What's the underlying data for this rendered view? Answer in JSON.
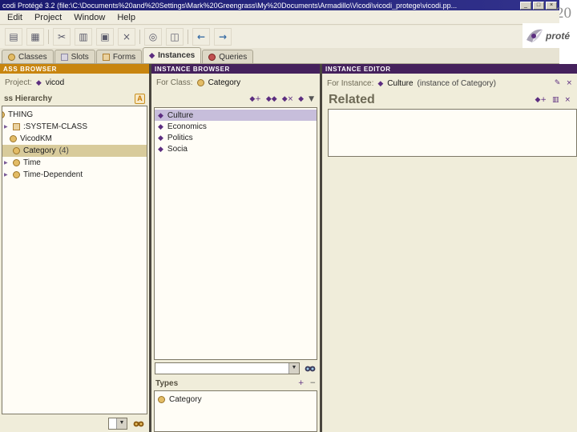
{
  "slide": {
    "page_number": "20"
  },
  "window": {
    "title": "codi  Protégé 3.2    (file:\\C:\\Documents%20and%20Settings\\Mark%20Greengrass\\My%20Documents\\Armadillo\\Vicodi\\vicodi_protege\\vicodi.pp...",
    "minimize_glyph": "_",
    "maximize_glyph": "□",
    "close_glyph": "×"
  },
  "menubar": {
    "items": [
      "Edit",
      "Project",
      "Window",
      "Help"
    ]
  },
  "toolbar": {
    "icons": [
      {
        "name": "new-project",
        "glyph": "▤"
      },
      {
        "name": "save-project",
        "glyph": "▦"
      },
      {
        "name": "cut",
        "glyph": "✂"
      },
      {
        "name": "copy",
        "glyph": "▥"
      },
      {
        "name": "paste",
        "glyph": "▣"
      },
      {
        "name": "delete",
        "glyph": "×"
      },
      {
        "name": "find",
        "glyph": "◎"
      },
      {
        "name": "diagram",
        "glyph": "◫"
      },
      {
        "name": "back",
        "glyph": "←"
      },
      {
        "name": "forward",
        "glyph": "→"
      }
    ],
    "logo_text": "proté"
  },
  "tabs": [
    {
      "label": "Classes",
      "active": false
    },
    {
      "label": "Slots",
      "active": false
    },
    {
      "label": "Forms",
      "active": false
    },
    {
      "label": "Instances",
      "active": true
    },
    {
      "label": "Queries",
      "active": false
    }
  ],
  "class_browser": {
    "header": "ASS BROWSER",
    "project_label": "Project:",
    "project_name": "vicod",
    "hierarchy_label": "ss Hierarchy",
    "hierarchy_tool_glyph": "A",
    "tree": [
      {
        "label": "THING"
      },
      {
        "label": ":SYSTEM-CLASS"
      },
      {
        "label": "VicodKM"
      },
      {
        "label": "Category",
        "count": "(4)"
      },
      {
        "label": "Time"
      },
      {
        "label": "Time-Dependent"
      }
    ]
  },
  "instance_browser": {
    "header": "INSTANCE BROWSER",
    "for_class_label": "For Class:",
    "class_name": "Category",
    "tools": [
      {
        "name": "create-instance",
        "glyph": "◆+"
      },
      {
        "name": "copy-instance",
        "glyph": "◆◆"
      },
      {
        "name": "delete-instance",
        "glyph": "◆×"
      },
      {
        "name": "view-instance",
        "glyph": "◆"
      },
      {
        "name": "list-menu",
        "glyph": "▼"
      }
    ],
    "instances": [
      "Culture",
      "Economics",
      "Politics",
      "Socia"
    ],
    "selected_instance": "Culture",
    "types_label": "Types",
    "types_tools": [
      {
        "name": "add-type",
        "glyph": "+"
      },
      {
        "name": "remove-type",
        "glyph": "−"
      }
    ],
    "types": [
      "Category"
    ]
  },
  "instance_editor": {
    "header": "INSTANCE EDITOR",
    "for_instance_label": "For Instance:",
    "instance_name": "Culture",
    "instance_note": "(instance of Category)",
    "header_tools": [
      {
        "name": "annotate",
        "glyph": "✎"
      },
      {
        "name": "close",
        "glyph": "×"
      }
    ],
    "related_label": "Related",
    "related_tools": [
      {
        "name": "create-related",
        "glyph": "◆+"
      },
      {
        "name": "add-related",
        "glyph": "▥"
      },
      {
        "name": "remove-related",
        "glyph": "×"
      }
    ]
  },
  "colors": {
    "header_purple": "#45215c",
    "header_orange": "#c8850f",
    "class_icon_fill": "#e3bc66",
    "instance_icon": "#5c2d80",
    "tree_selection": "#d8cb9b",
    "list_selection": "#c7bedb"
  }
}
